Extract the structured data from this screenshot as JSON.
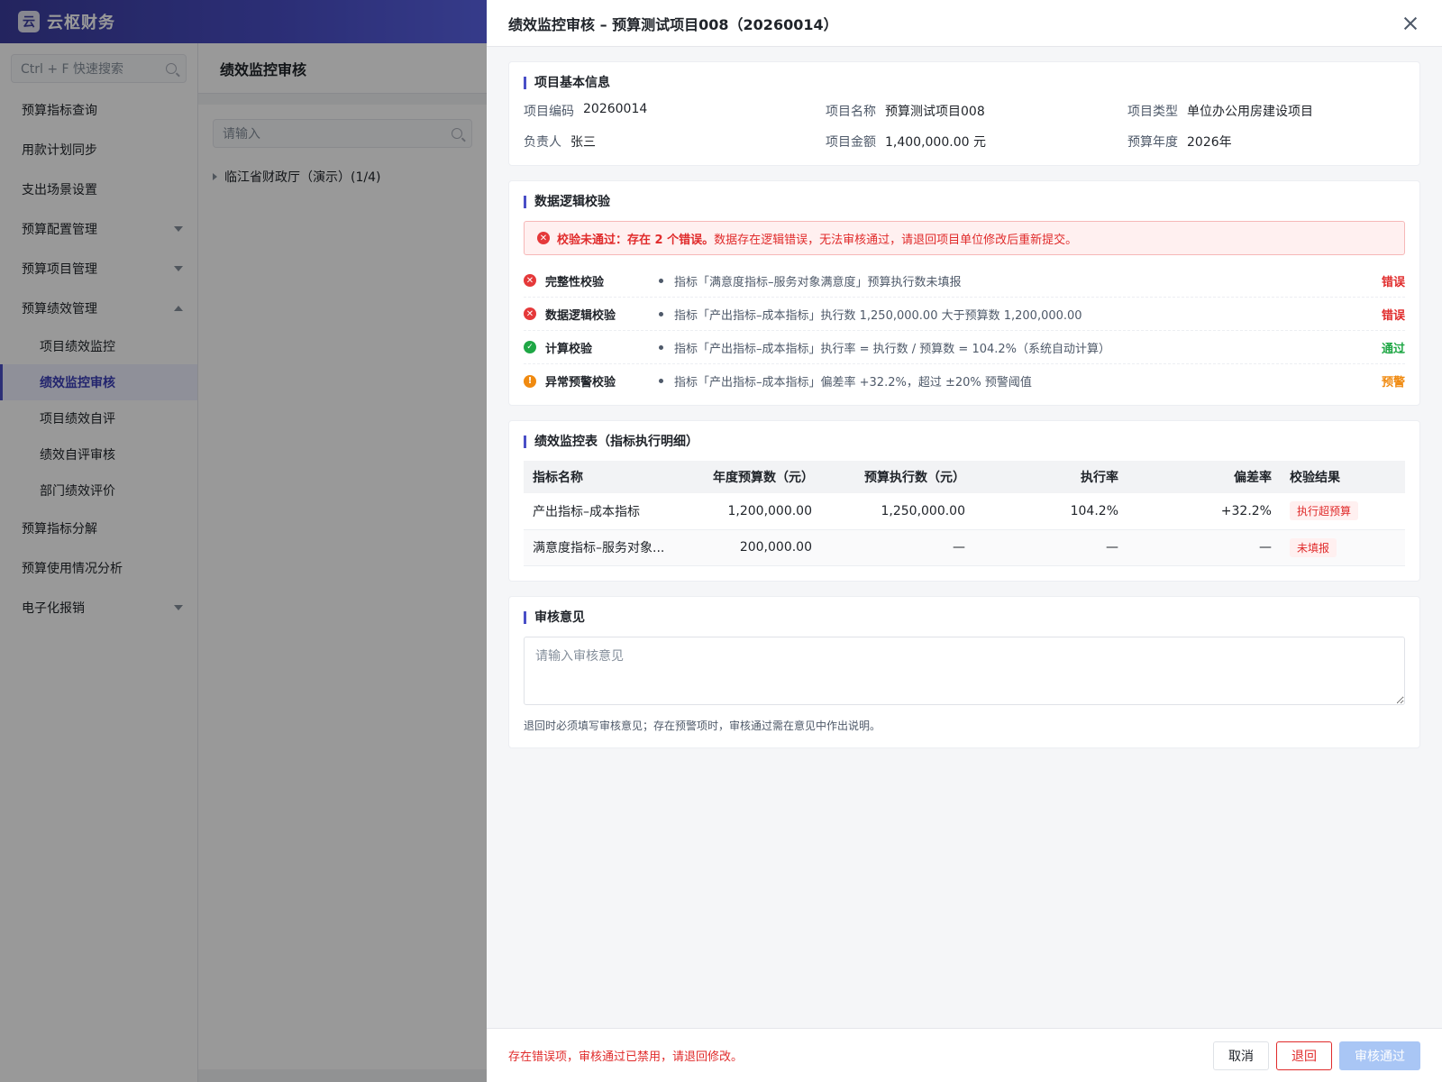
{
  "app": {
    "logo_char": "云",
    "name": "云枢财务"
  },
  "sidebar": {
    "search_placeholder": "Ctrl + F 快速搜索",
    "items": [
      {
        "label": "预算指标查询"
      },
      {
        "label": "用款计划同步"
      },
      {
        "label": "支出场景设置"
      },
      {
        "label": "预算配置管理",
        "expandable": true,
        "expanded": false
      },
      {
        "label": "预算项目管理",
        "expandable": true,
        "expanded": false
      },
      {
        "label": "预算绩效管理",
        "expandable": true,
        "expanded": true
      },
      {
        "label": "预算指标分解"
      },
      {
        "label": "预算使用情况分析"
      },
      {
        "label": "电子化报销",
        "expandable": true,
        "expanded": false
      }
    ],
    "subitems": [
      {
        "label": "项目绩效监控"
      },
      {
        "label": "绩效监控审核",
        "active": true
      },
      {
        "label": "项目绩效自评"
      },
      {
        "label": "绩效自评审核"
      },
      {
        "label": "部门绩效评价"
      }
    ]
  },
  "page": {
    "title": "绩效监控审核",
    "tree_search_placeholder": "请输入",
    "tree_node": "临江省财政厅（演示）(1/4)"
  },
  "drawer": {
    "title": "绩效监控审核 – 预算测试项目008（20260014）",
    "basic": {
      "title": "项目基本信息",
      "fields": [
        {
          "label": "项目编码",
          "value": "20260014"
        },
        {
          "label": "项目名称",
          "value": "预算测试项目008"
        },
        {
          "label": "项目类型",
          "value": "单位办公用房建设项目"
        },
        {
          "label": "负责人",
          "value": "张三"
        },
        {
          "label": "项目金额",
          "value": "1,400,000.00 元"
        },
        {
          "label": "预算年度",
          "value": "2026年"
        }
      ]
    },
    "validation": {
      "title": "数据逻辑校验",
      "alert_strong": "校验未通过：存在 2 个错误。",
      "alert_text": "数据存在逻辑错误，无法审核通过，请退回项目单位修改后重新提交。",
      "checks": [
        {
          "name": "完整性校验",
          "message": "指标「满意度指标–服务对象满意度」预算执行数未填报",
          "result": "错误",
          "status": "error"
        },
        {
          "name": "数据逻辑校验",
          "message": "指标「产出指标–成本指标」执行数 1,250,000.00 大于预算数 1,200,000.00",
          "result": "错误",
          "status": "error"
        },
        {
          "name": "计算校验",
          "message": "指标「产出指标–成本指标」执行率 = 执行数 / 预算数 = 104.2%（系统自动计算）",
          "result": "通过",
          "status": "ok"
        },
        {
          "name": "异常预警校验",
          "message": "指标「产出指标–成本指标」偏差率 +32.2%，超过 ±20% 预警阈值",
          "result": "预警",
          "status": "warn"
        }
      ]
    },
    "table": {
      "title": "绩效监控表（指标执行明细）",
      "columns": [
        "指标名称",
        "年度预算数（元）",
        "预算执行数（元）",
        "执行率",
        "偏差率",
        "校验结果"
      ],
      "rows": [
        {
          "name": "产出指标–成本指标",
          "budget": "1,200,000.00",
          "executed": "1,250,000.00",
          "rate": "104.2%",
          "deviation": "+32.2%",
          "result": "执行超预算"
        },
        {
          "name": "满意度指标–服务对象...",
          "budget": "200,000.00",
          "executed": "—",
          "rate": "—",
          "deviation": "—",
          "result": "未填报"
        }
      ]
    },
    "opinion": {
      "title": "审核意见",
      "placeholder": "请输入审核意见",
      "hint": "退回时必须填写审核意见；存在预警项时，审核通过需在意见中作出说明。"
    },
    "footer": {
      "warning": "存在错误项，审核通过已禁用，请退回修改。",
      "cancel": "取消",
      "return": "退回",
      "approve": "审核通过"
    }
  },
  "colors": {
    "accent": "#4a4fc7",
    "error": "#e02b2b",
    "success": "#1fa745",
    "warning": "#f08a10"
  }
}
